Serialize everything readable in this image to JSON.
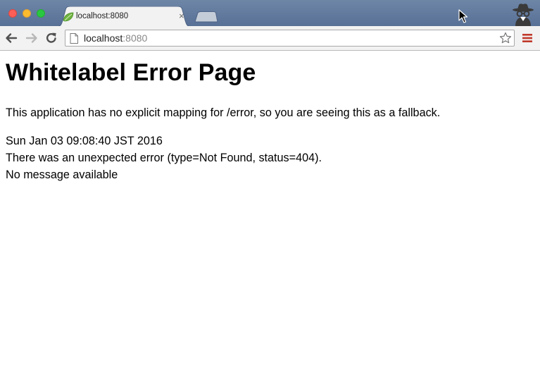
{
  "browser": {
    "tab": {
      "title": "localhost:8080",
      "close_glyph": "×",
      "favicon": "spring-leaf-icon"
    },
    "omnibox": {
      "host": "localhost",
      "port": ":8080"
    },
    "icons": {
      "back": "back-arrow-icon",
      "forward": "forward-arrow-icon",
      "reload": "reload-icon",
      "bookmark": "star-icon",
      "menu": "hamburger-menu-icon",
      "incognito": "incognito-icon"
    },
    "colors": {
      "titlebar": "#587096",
      "menu_accent": "#c0392b"
    }
  },
  "page": {
    "heading": "Whitelabel Error Page",
    "explanation": "This application has no explicit mapping for /error, so you are seeing this as a fallback.",
    "timestamp": "Sun Jan 03 09:08:40 JST 2016",
    "error_line": "There was an unexpected error (type=Not Found, status=404).",
    "message": "No message available"
  }
}
